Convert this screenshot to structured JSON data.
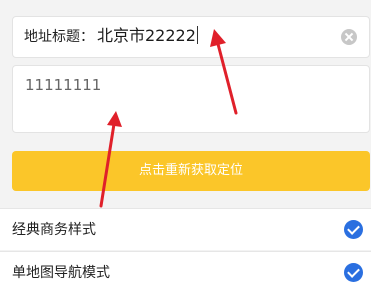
{
  "title_field": {
    "label": "地址标题：",
    "value": "北京市22222"
  },
  "detail_field": {
    "value": "11111111"
  },
  "relocate_button": {
    "label": "点击重新获取定位"
  },
  "map_styles": [
    {
      "label": "经典商务样式",
      "selected": true
    },
    {
      "label": "单地图导航模式",
      "selected": true
    }
  ],
  "colors": {
    "accent_button": "#fbc629",
    "check": "#2a6fe0",
    "annotation": "#e0202a"
  },
  "icons": [
    "clear-icon",
    "check-icon",
    "annotation-arrow"
  ]
}
